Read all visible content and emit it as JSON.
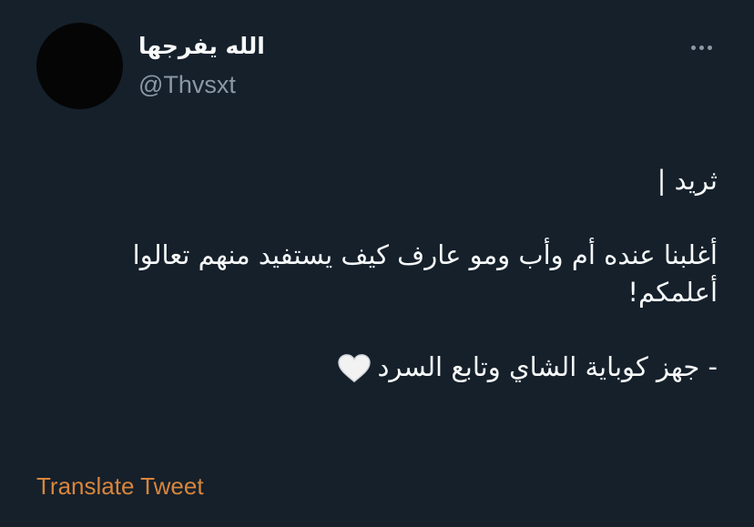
{
  "author": {
    "display_name": "الله يفرجها",
    "username": "@Thvsxt"
  },
  "more_icon": "more-horizontal-icon",
  "tweet": {
    "line1": "ثريد |",
    "line2": "أغلبنا عنده أم وأب ومو عارف كيف يستفيد منهم تعالوا",
    "line3": "أعلمكم!",
    "line4": "- جهز كوباية الشاي وتابع السرد",
    "emoji": "white-heart-icon"
  },
  "translate_label": "Translate Tweet",
  "colors": {
    "background": "#15202b",
    "text": "#f7f9f9",
    "secondary": "#8b98a5",
    "link": "#d9853b"
  }
}
